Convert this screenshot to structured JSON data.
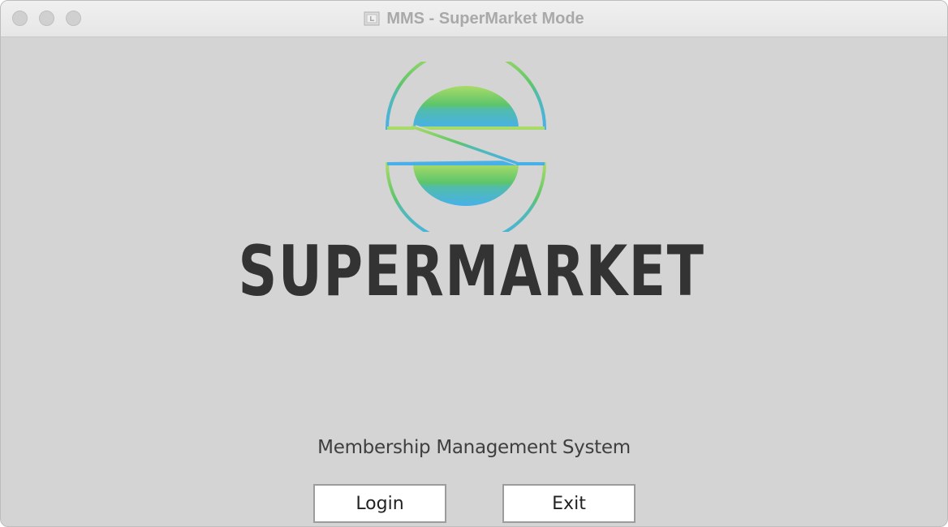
{
  "window": {
    "title": "MMS - SuperMarket Mode",
    "icon": "document-icon"
  },
  "logo": {
    "wordmark": "SuperMarket",
    "wordmark_display": "SUPERMARKET",
    "colors": {
      "gradient_top": "#a6d86a",
      "gradient_mid": "#58c46b",
      "gradient_bottom": "#4bb3e8",
      "wordmark": "#333333"
    }
  },
  "main": {
    "subtitle": "Membership Management System"
  },
  "buttons": {
    "login": "Login",
    "exit": "Exit"
  }
}
